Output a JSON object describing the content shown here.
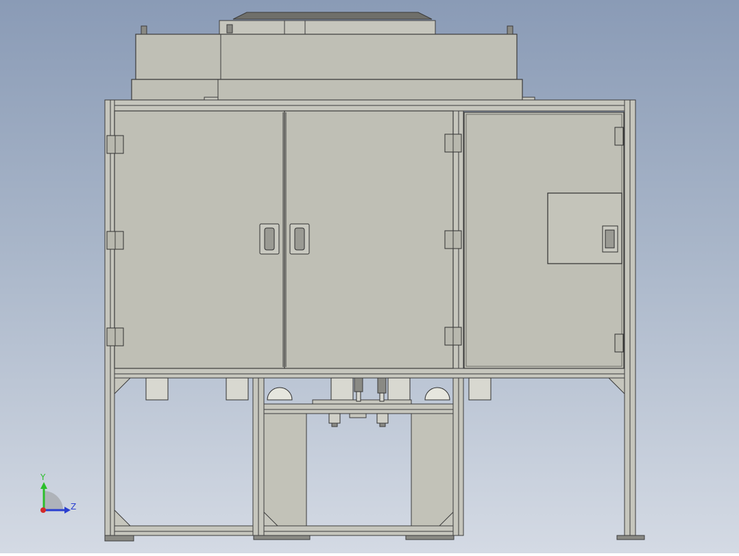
{
  "view": {
    "background_top": "#8a9bb6",
    "background_bottom": "#d4dae4",
    "model_color": "#bfbfb5",
    "edge_color": "#3b3b3b"
  },
  "triad": {
    "y_label": "Y",
    "z_label": "Z",
    "y_color": "#2bbf2b",
    "z_color": "#2a3fcf",
    "origin_color": "#d42a2a"
  }
}
